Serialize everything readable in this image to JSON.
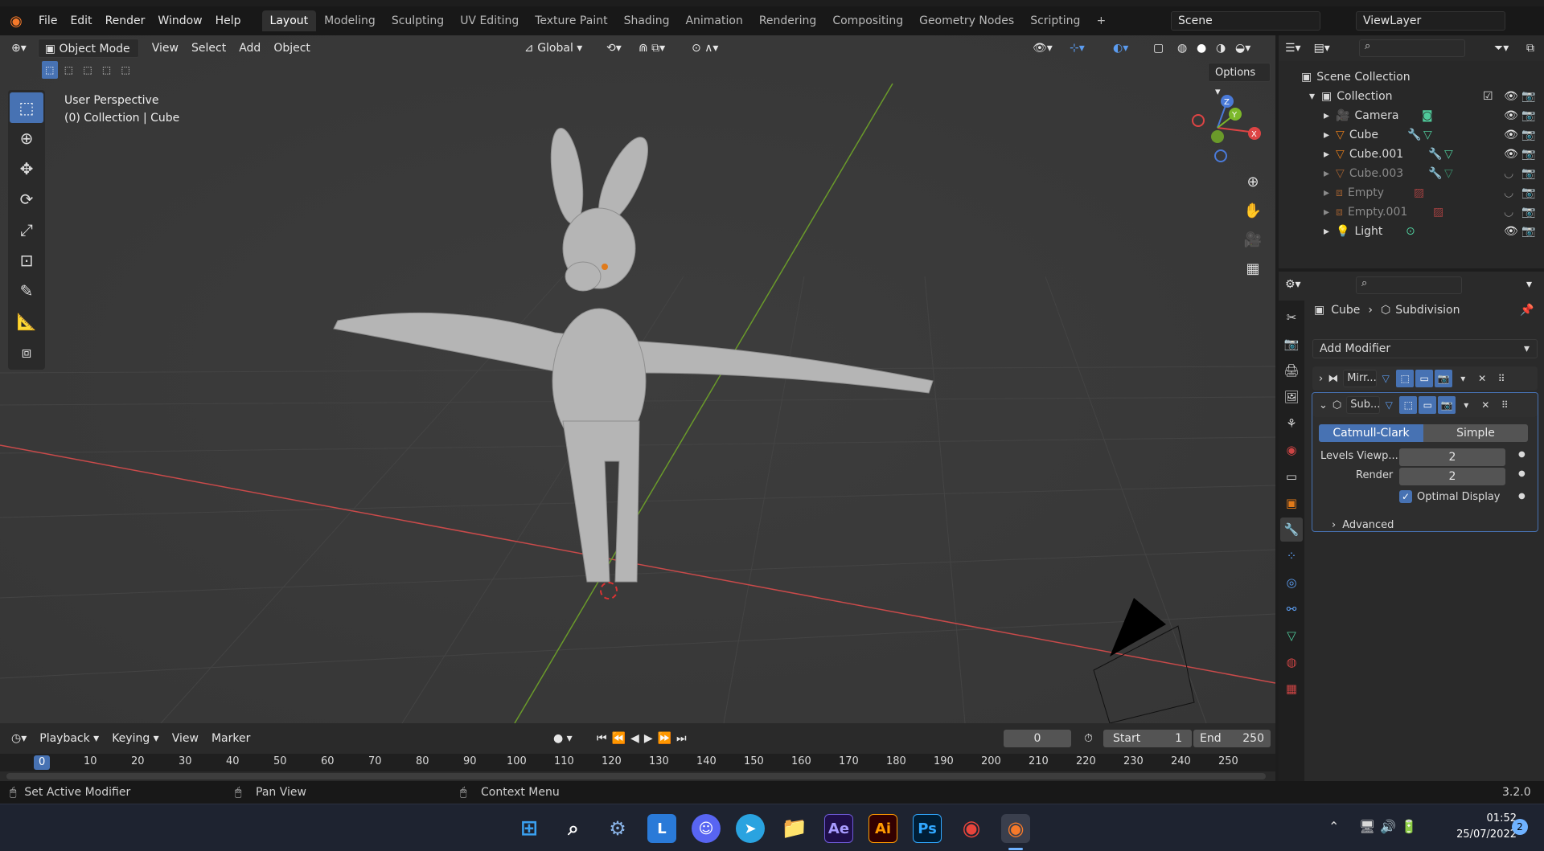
{
  "topbar": {
    "menus": [
      "File",
      "Edit",
      "Render",
      "Window",
      "Help"
    ],
    "workspaces": [
      "Layout",
      "Modeling",
      "Sculpting",
      "UV Editing",
      "Texture Paint",
      "Shading",
      "Animation",
      "Rendering",
      "Compositing",
      "Geometry Nodes",
      "Scripting"
    ],
    "active_workspace": "Layout",
    "scene": "Scene",
    "view_layer": "ViewLayer"
  },
  "viewport": {
    "mode": "Object Mode",
    "menus": [
      "View",
      "Select",
      "Add",
      "Object"
    ],
    "orientation": "Global",
    "options": "Options",
    "perspective_label": "User Perspective",
    "collection_label": "(0) Collection | Cube",
    "axes": {
      "z": "Z",
      "y": "Y",
      "x": "X"
    }
  },
  "outliner": {
    "scene_collection": "Scene Collection",
    "collection": "Collection",
    "items": [
      {
        "name": "Camera",
        "visible": true
      },
      {
        "name": "Cube",
        "visible": true
      },
      {
        "name": "Cube.001",
        "visible": true
      },
      {
        "name": "Cube.003",
        "visible": false
      },
      {
        "name": "Empty",
        "visible": false
      },
      {
        "name": "Empty.001",
        "visible": false
      },
      {
        "name": "Light",
        "visible": true
      }
    ]
  },
  "properties": {
    "breadcrumb_object": "Cube",
    "breadcrumb_modifier": "Subdivision",
    "add_modifier": "Add Modifier",
    "modifiers": [
      {
        "name": "Mirr...",
        "expanded": false
      },
      {
        "name": "Sub...",
        "expanded": true
      }
    ],
    "subdiv_types": [
      "Catmull-Clark",
      "Simple"
    ],
    "active_type": "Catmull-Clark",
    "levels_label": "Levels Viewp...",
    "levels_value": "2",
    "render_label": "Render",
    "render_value": "2",
    "optimal_display": "Optimal Display",
    "advanced": "Advanced"
  },
  "timeline": {
    "menus": [
      "Playback",
      "Keying",
      "View",
      "Marker"
    ],
    "current_frame": "0",
    "start_label": "Start",
    "start_value": "1",
    "end_label": "End",
    "end_value": "250",
    "ruler": [
      "0",
      "10",
      "20",
      "30",
      "40",
      "50",
      "60",
      "70",
      "80",
      "90",
      "100",
      "110",
      "120",
      "130",
      "140",
      "150",
      "160",
      "170",
      "180",
      "190",
      "200",
      "210",
      "220",
      "230",
      "240",
      "250"
    ]
  },
  "statusbar": {
    "left": "Set Active Modifier",
    "middle": "Pan View",
    "right": "Context Menu",
    "version": "3.2.0"
  },
  "taskbar": {
    "time": "01:52",
    "date": "25/07/2022",
    "notifications": "2",
    "apps": [
      "windows-start",
      "search",
      "settings",
      "L",
      "discord",
      "telegram",
      "files",
      "Ae",
      "Ai",
      "Ps",
      "chrome",
      "blender"
    ]
  }
}
